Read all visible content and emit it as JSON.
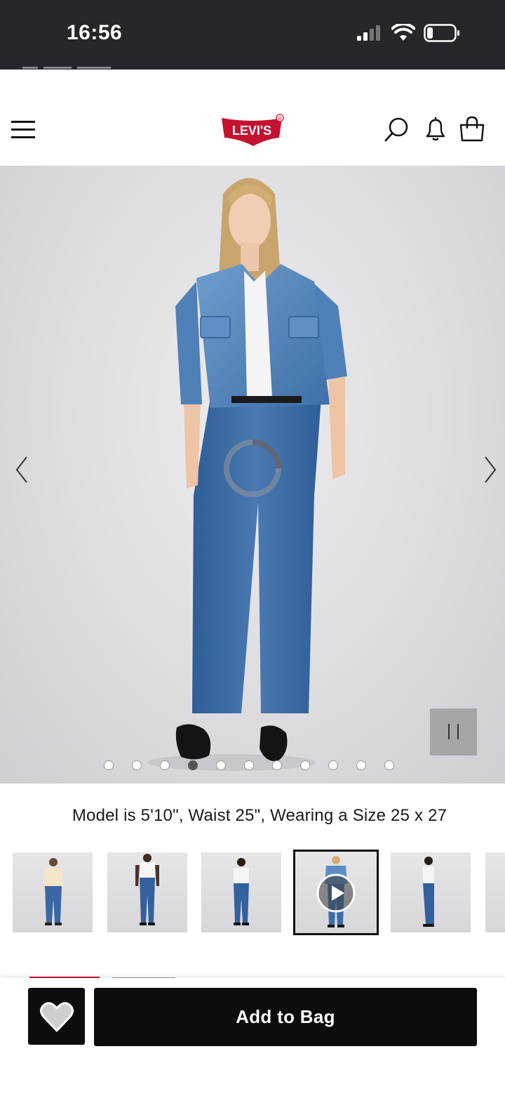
{
  "status_bar": {
    "time": "16:56"
  },
  "header": {
    "logo_text": "Levi's",
    "menu_icon": "hamburger-menu-icon",
    "search_icon": "search-icon",
    "notification_icon": "bell-icon",
    "bag_icon": "shopping-bag-icon",
    "brand_color": "#c41230"
  },
  "gallery": {
    "prev_icon": "chevron-left-icon",
    "next_icon": "chevron-right-icon",
    "pause_icon": "pause-icon",
    "loading_icon": "spinner-icon",
    "slide_count": 11,
    "active_slide": 4
  },
  "model_info": "Model is 5'10\", Waist 25\", Wearing a Size 25 x 27",
  "thumbnails": [
    {
      "label": "front-with-sweater",
      "selected": false
    },
    {
      "label": "front-dark-model",
      "selected": false
    },
    {
      "label": "back-view",
      "selected": false
    },
    {
      "label": "video-front",
      "selected": true,
      "has_video": true
    },
    {
      "label": "side-view",
      "selected": false
    }
  ],
  "actions": {
    "wishlist_icon": "heart-icon",
    "add_to_bag": "Add to Bag"
  }
}
